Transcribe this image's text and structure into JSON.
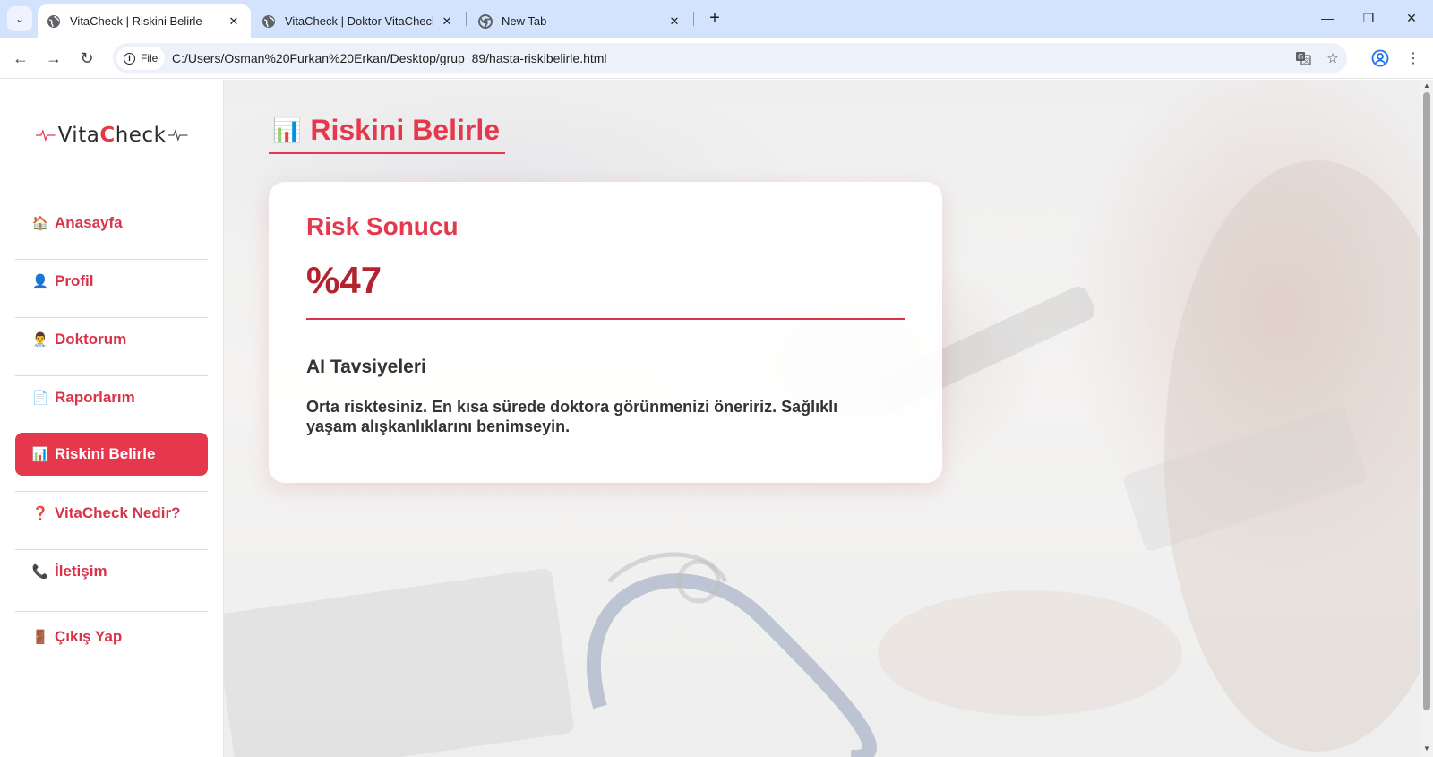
{
  "browser": {
    "tabs": [
      {
        "title": "VitaCheck | Riskini Belirle",
        "active": true
      },
      {
        "title": "VitaCheck | Doktor VitaCheck N",
        "active": false
      },
      {
        "title": "New Tab",
        "active": false
      }
    ],
    "file_chip": "File",
    "url": "C:/Users/Osman%20Furkan%20Erkan/Desktop/grup_89/hasta-riskibelirle.html"
  },
  "logo": {
    "part1": "Vita",
    "part2": "C",
    "part3": "heck"
  },
  "sidebar": {
    "items": [
      {
        "icon": "🏠",
        "label": "Anasayfa"
      },
      {
        "icon": "👤",
        "label": "Profil"
      },
      {
        "icon": "👨‍⚕️",
        "label": "Doktorum"
      },
      {
        "icon": "📄",
        "label": "Raporlarım"
      },
      {
        "icon": "📊",
        "label": "Riskini Belirle"
      },
      {
        "icon": "❓",
        "label": "VitaCheck Nedir?"
      },
      {
        "icon": "📞",
        "label": "İletişim"
      },
      {
        "icon": "🚪",
        "label": "Çıkış Yap"
      }
    ]
  },
  "page": {
    "title_icon": "📊",
    "title": "Riskini Belirle",
    "result_heading": "Risk Sonucu",
    "risk_value": "%47",
    "ai_heading": "AI Tavsiyeleri",
    "ai_text": "Orta risktesiniz. En kısa sürede doktora görünmenizi öneririz. Sağlıklı yaşam alışkanlıklarını benimseyin."
  },
  "colors": {
    "accent": "#e5384c",
    "score": "#b3232f",
    "browser_frame": "#d3e3fd"
  }
}
